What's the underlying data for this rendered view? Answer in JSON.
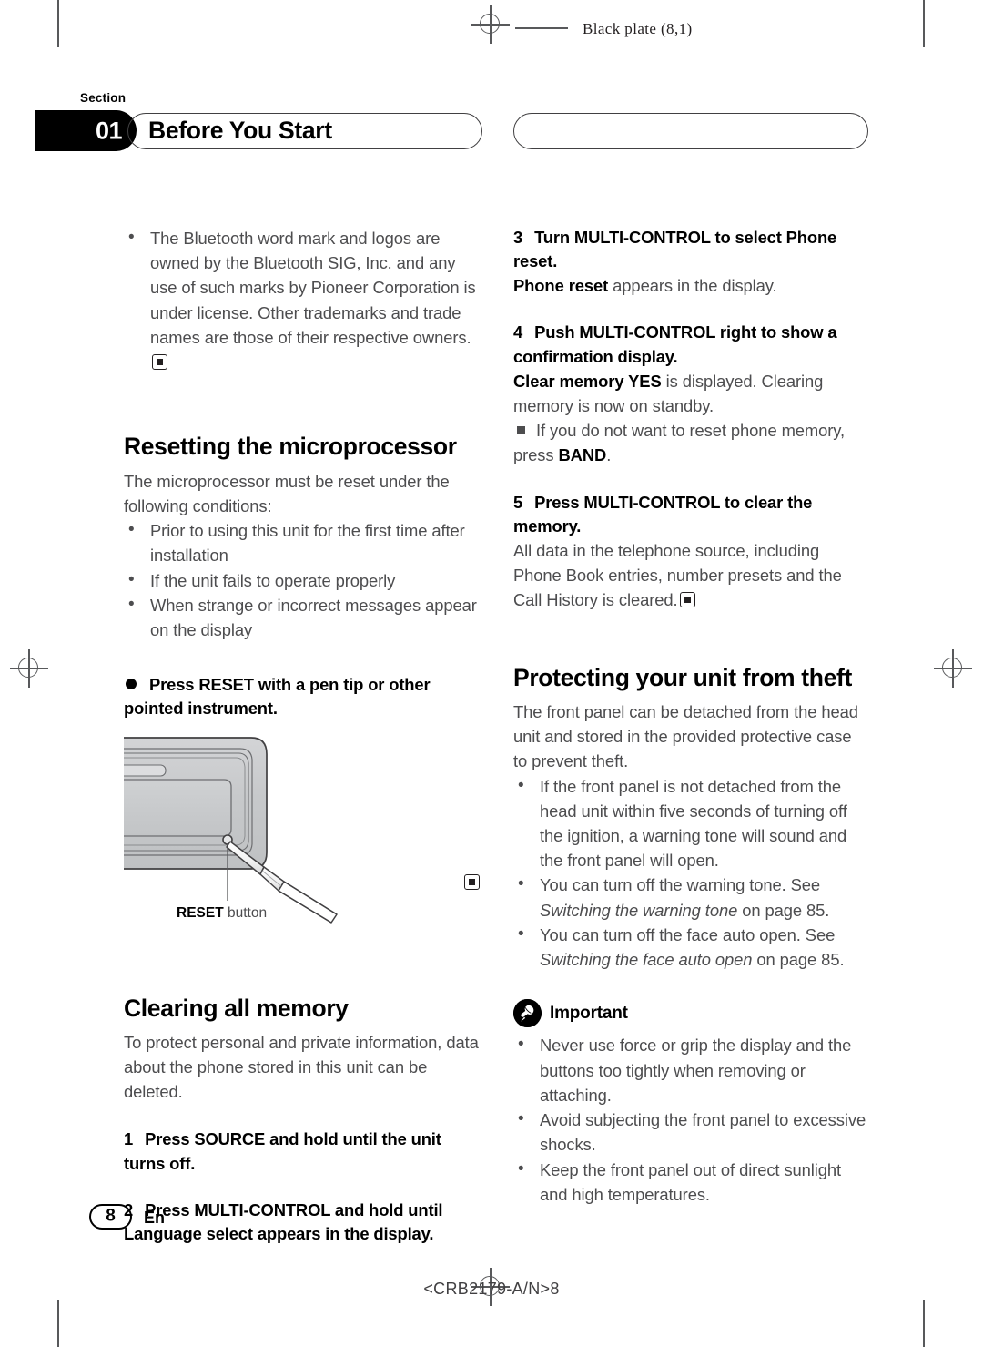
{
  "page": {
    "black_plate": "Black plate (8,1)",
    "section_label": "Section",
    "section_number": "01",
    "section_title": "Before You Start",
    "page_number": "8",
    "language_code": "En",
    "doc_code": "<CRB2179-A/N>8"
  },
  "left_column": {
    "trademark_bullet": "The Bluetooth word mark and logos are owned by the Bluetooth SIG, Inc. and any use of such marks by Pioneer Corporation is under license. Other trademarks and trade names are those of their respective owners.",
    "reset_heading": "Resetting the microprocessor",
    "reset_intro": "The microprocessor must be reset under the following conditions:",
    "reset_conditions": [
      "Prior to using this unit for the first time after installation",
      "If the unit fails to operate properly",
      "When strange or incorrect messages appear on the display"
    ],
    "reset_action": "Press RESET with a pen tip or other pointed instrument.",
    "figure_caption_bold": "RESET",
    "figure_caption_rest": " button",
    "clearing_heading": "Clearing all memory",
    "clearing_intro": "To protect personal and private information, data about the phone stored in this unit can be deleted.",
    "steps": [
      {
        "number": "1",
        "text": "Press SOURCE and hold until the unit turns off."
      },
      {
        "number": "2",
        "text": "Press MULTI-CONTROL and hold until Language select appears in the display."
      }
    ]
  },
  "right_column": {
    "step3": {
      "number": "3",
      "text": "Turn MULTI-CONTROL to select Phone reset."
    },
    "step3_note_bold": "Phone reset",
    "step3_note_rest": " appears in the display.",
    "step4": {
      "number": "4",
      "text": "Push MULTI-CONTROL right to show a confirmation display."
    },
    "step4_note_bold": "Clear memory YES",
    "step4_note_rest": " is displayed. Clearing memory is now on standby.",
    "step4_subnote_a": "If you do not want to reset phone memory, press ",
    "step4_subnote_bold": "BAND",
    "step4_subnote_b": ".",
    "step5": {
      "number": "5",
      "text": "Press MULTI-CONTROL to clear the memory."
    },
    "step5_note": "All data in the telephone source, including Phone Book entries, number presets and the Call History is cleared.",
    "theft_heading": "Protecting your unit from theft",
    "theft_intro": "The front panel can be detached from the head unit and stored in the provided protective case to prevent theft.",
    "theft_bullet_1": "If the front panel is not detached from the head unit within five seconds of turning off the ignition, a warning tone will sound and the front panel will open.",
    "theft_bullet_2_a": "You can turn off the warning tone. See ",
    "theft_bullet_2_italic": "Switching the warning tone",
    "theft_bullet_2_b": " on page 85.",
    "theft_bullet_3_a": "You can turn off the face auto open. See ",
    "theft_bullet_3_italic": "Switching the face auto open",
    "theft_bullet_3_b": " on page 85.",
    "important_label": "Important",
    "important_bullets": [
      "Never use force or grip the display and the buttons too tightly when removing or attaching.",
      "Avoid subjecting the front panel to excessive shocks.",
      "Keep the front panel out of direct sunlight and high temperatures."
    ]
  }
}
